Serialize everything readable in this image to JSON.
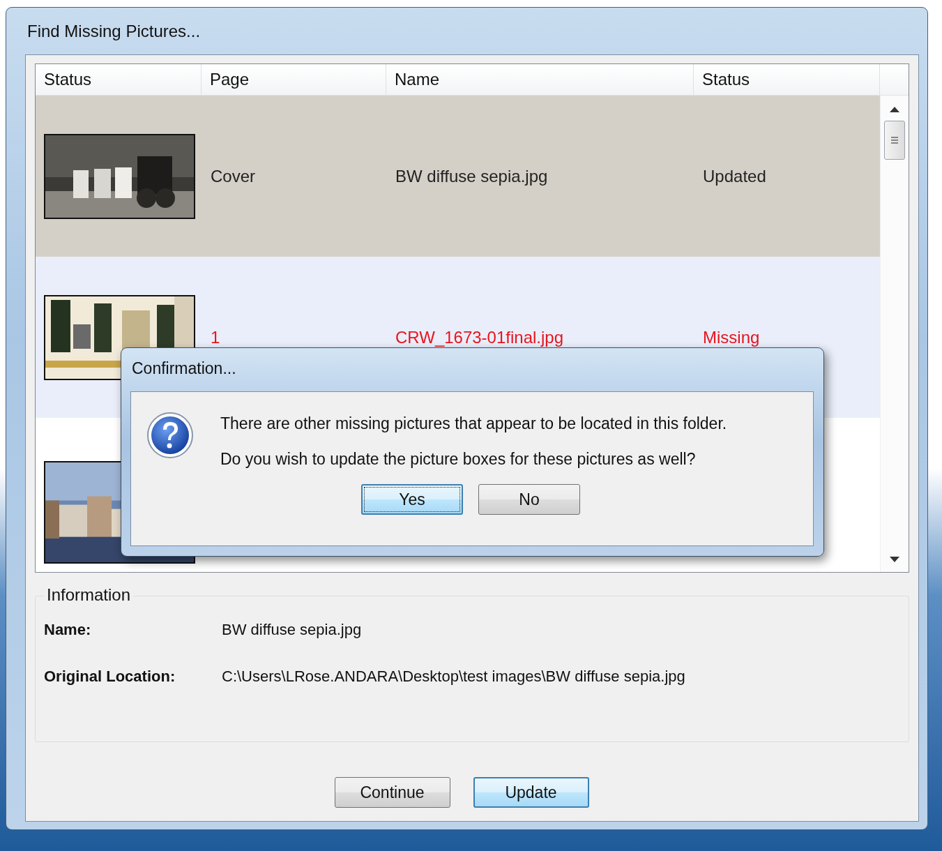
{
  "window": {
    "title": "Find Missing Pictures..."
  },
  "table": {
    "columns": [
      "Status",
      "Page",
      "Name",
      "Status"
    ],
    "rows": [
      {
        "page": "Cover",
        "name": "BW diffuse sepia.jpg",
        "status": "Updated",
        "selected": true,
        "hovered": false,
        "missing": false
      },
      {
        "page": "1",
        "name": "CRW_1673-01final.jpg",
        "status": "Missing",
        "selected": false,
        "hovered": true,
        "missing": true
      },
      {
        "selected": false,
        "hovered": false
      }
    ]
  },
  "dialog": {
    "title": "Confirmation...",
    "lines": [
      "There are other missing pictures that appear to be located in this folder.",
      "Do you wish to update the picture boxes for these pictures as well?"
    ],
    "buttons": [
      {
        "label": "Yes",
        "focused": true
      },
      {
        "label": "No",
        "focused": false
      }
    ]
  },
  "information": {
    "title": "Information",
    "fields": [
      {
        "label": "Name:",
        "value": "BW diffuse sepia.jpg"
      },
      {
        "label": "Original Location:",
        "value": "C:\\Users\\LRose.ANDARA\\Desktop\\test images\\BW diffuse sepia.jpg"
      }
    ]
  },
  "buttons": [
    {
      "label": "Continue",
      "default": false
    },
    {
      "label": "Update",
      "default": true
    }
  ]
}
